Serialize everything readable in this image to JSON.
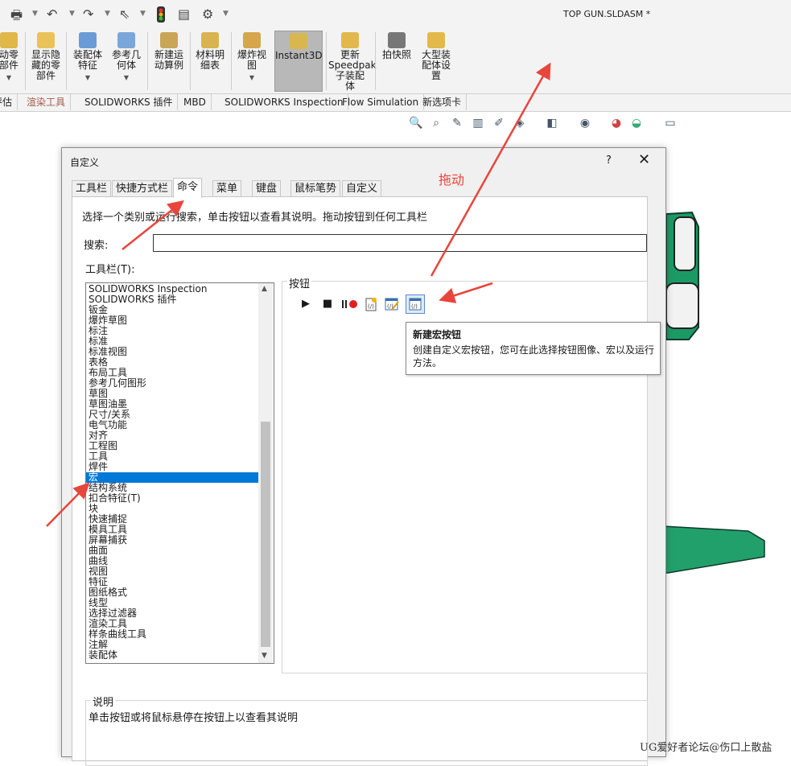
{
  "window": {
    "title": "TOP GUN.SLDASM *"
  },
  "ribbon": {
    "buttons": [
      {
        "label": "动零\n部件"
      },
      {
        "label": "显示隐\n藏的零\n部件"
      },
      {
        "label": "装配体\n特征"
      },
      {
        "label": "参考几\n何体"
      },
      {
        "label": "新建运\n动算例"
      },
      {
        "label": "材料明\n细表"
      },
      {
        "label": "爆炸视\n图"
      },
      {
        "label": "Instant3D"
      },
      {
        "label": "更新\nSpeedpak\n子装配\n体"
      },
      {
        "label": "拍快照"
      },
      {
        "label": "大型装\n配体设\n置"
      }
    ],
    "tabs": [
      "评估",
      "渲染工具",
      "SOLIDWORKS 插件",
      "MBD",
      "SOLIDWORKS Inspection",
      "Flow Simulation",
      "新选项卡"
    ]
  },
  "dialog": {
    "title": "自定义",
    "help": "?",
    "close": "✕",
    "tabs": [
      "工具栏",
      "快捷方式栏",
      "命令",
      "菜单",
      "键盘",
      "鼠标笔势",
      "自定义"
    ],
    "active_tab": "命令",
    "instruction": "选择一个类别或运行搜索，单击按钮以查看其说明。拖动按钮到任何工具栏",
    "search_label": "搜索:",
    "search_value": "",
    "toolbar_label": "工具栏(T):",
    "toolbar_items": [
      "SOLIDWORKS Inspection",
      "SOLIDWORKS 插件",
      "钣金",
      "爆炸草图",
      "标注",
      "标准",
      "标准视图",
      "表格",
      "布局工具",
      "参考几何图形",
      "草图",
      "草图油墨",
      "尺寸/关系",
      "电气功能",
      "对齐",
      "工程图",
      "工具",
      "焊件",
      "宏",
      "结构系统",
      "扣合特征(T)",
      "块",
      "快速捕捉",
      "模具工具",
      "屏幕捕获",
      "曲面",
      "曲线",
      "视图",
      "特征",
      "图纸格式",
      "线型",
      "选择过滤器",
      "渲染工具",
      "样条曲线工具",
      "注解",
      "装配体"
    ],
    "selected_item": "宏",
    "buttons_group_label": "按钮",
    "buttons_icons": [
      "play-icon",
      "stop-icon",
      "pause-record-icon",
      "new-macro-file-icon",
      "edit-macro-icon",
      "new-macro-button-icon"
    ],
    "tooltip": {
      "title": "新建宏按钮",
      "body": "创建自定义宏按钮，您可在此选择按钮图像、宏以及运行方法。"
    },
    "description_label": "说明",
    "description_text": "单击按钮或将鼠标悬停在按钮上以查看其说明"
  },
  "annotation": {
    "drag_label": "拖动",
    "arrow_color": "#e8453c"
  },
  "watermark": "UG爱好者论坛@伤口上散盐"
}
